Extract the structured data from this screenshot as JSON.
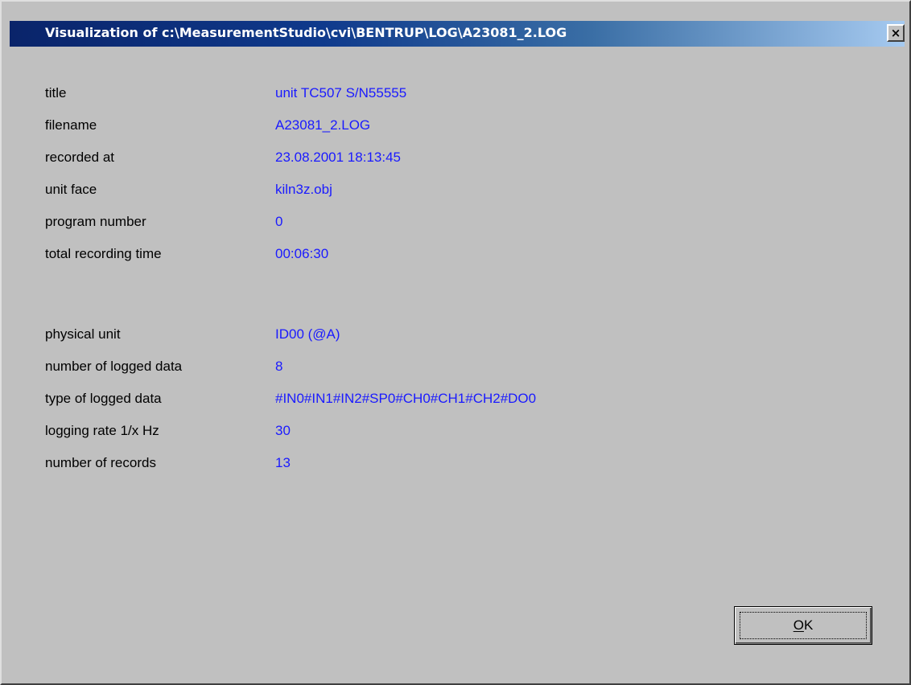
{
  "window": {
    "title": "Visualization of c:\\MeasurementStudio\\cvi\\BENTRUP\\LOG\\A23081_2.LOG",
    "close_symbol": "×",
    "close_icon": "close-icon"
  },
  "info": {
    "group1": [
      {
        "label": "title",
        "value": "unit TC507 S/N55555"
      },
      {
        "label": "filename",
        "value": "A23081_2.LOG"
      },
      {
        "label": "recorded at",
        "value": "23.08.2001 18:13:45"
      },
      {
        "label": "unit face",
        "value": "kiln3z.obj"
      },
      {
        "label": "program number",
        "value": "0"
      },
      {
        "label": "total recording time",
        "value": "00:06:30"
      }
    ],
    "group2": [
      {
        "label": "physical unit",
        "value": "ID00 (@A)"
      },
      {
        "label": "number of logged data",
        "value": "8"
      },
      {
        "label": "type of logged data",
        "value": "#IN0#IN1#IN2#SP0#CH0#CH1#CH2#DO0"
      },
      {
        "label": "logging rate 1/x Hz",
        "value": "30"
      },
      {
        "label": "number of records",
        "value": "13"
      }
    ]
  },
  "buttons": {
    "ok_mnemonic": "O",
    "ok_rest": "K"
  },
  "colors": {
    "value_text": "#1a1aff",
    "background": "#c0c0c0",
    "title_start": "#0a246a",
    "title_end": "#a6caf0"
  }
}
